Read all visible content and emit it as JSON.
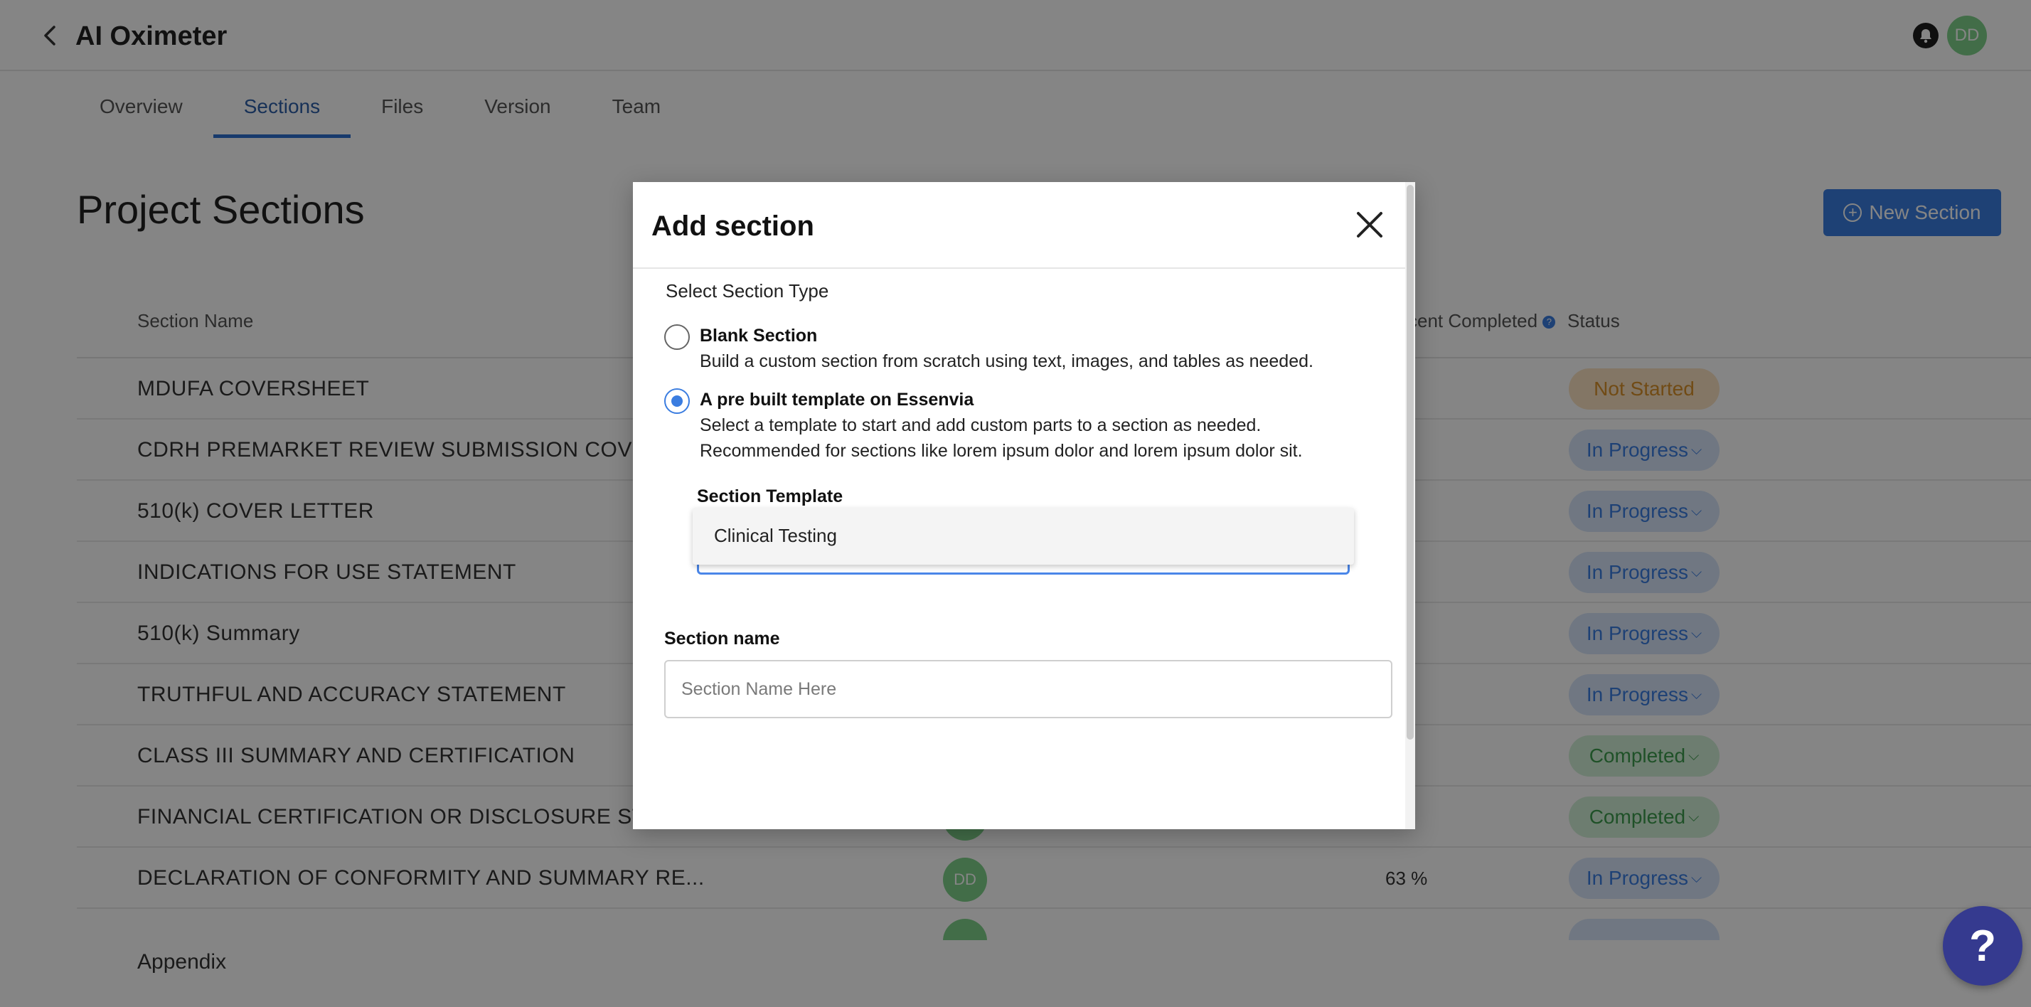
{
  "header": {
    "title": "AI Oximeter",
    "avatar_initials": "DD"
  },
  "tabs": [
    {
      "label": "Overview"
    },
    {
      "label": "Sections",
      "active": true
    },
    {
      "label": "Files"
    },
    {
      "label": "Version"
    },
    {
      "label": "Team"
    }
  ],
  "page": {
    "title": "Project Sections",
    "new_section_label": "New Section"
  },
  "table": {
    "col_name": "Section Name",
    "col_percent": "cent Completed",
    "col_status": "Status",
    "rows": [
      {
        "name": "MDUFA COVERSHEET",
        "owner": "",
        "percent": "",
        "status": "Not Started",
        "status_type": "notstarted"
      },
      {
        "name": "CDRH PREMARKET REVIEW SUBMISSION COVERS",
        "owner": "",
        "percent": "",
        "status": "In Progress",
        "status_type": "inprogress"
      },
      {
        "name": "510(k) COVER LETTER",
        "owner": "",
        "percent": "%",
        "status": "In Progress",
        "status_type": "inprogress"
      },
      {
        "name": "INDICATIONS FOR USE STATEMENT",
        "owner": "",
        "percent": "%",
        "status": "In Progress",
        "status_type": "inprogress"
      },
      {
        "name": "510(k) Summary",
        "owner": "",
        "percent": "%",
        "status": "In Progress",
        "status_type": "inprogress"
      },
      {
        "name": "TRUTHFUL AND ACCURACY STATEMENT",
        "owner": "",
        "percent": "%",
        "status": "In Progress",
        "status_type": "inprogress"
      },
      {
        "name": "CLASS III SUMMARY AND CERTIFICATION",
        "owner": "",
        "percent": "%",
        "status": "Completed",
        "status_type": "completed"
      },
      {
        "name": "FINANCIAL CERTIFICATION OR DISCLOSURE ST...",
        "owner": "",
        "percent": "%",
        "status": "Completed",
        "status_type": "completed"
      },
      {
        "name": "DECLARATION OF CONFORMITY AND SUMMARY RE...",
        "owner": "DD",
        "percent": "63 %",
        "status": "In Progress",
        "status_type": "inprogress"
      }
    ],
    "appendix_label": "Appendix"
  },
  "modal": {
    "title": "Add section",
    "type_label": "Select Section Type",
    "options": [
      {
        "title": "Blank Section",
        "desc1": "Build a custom section from scratch using text, images, and tables as needed.",
        "selected": false
      },
      {
        "title": "A pre built template on Essenvia",
        "desc1": "Select a template to start and add custom parts to a section as needed.",
        "desc2": "Recommended for sections like lorem ipsum dolor and lorem ipsum dolor sit.",
        "selected": true
      }
    ],
    "template_label": "Section Template",
    "template_options": [
      "Clinical Testing"
    ],
    "name_label": "Section name",
    "name_placeholder": "Section Name Here",
    "name_value": ""
  },
  "help_label": "?",
  "colors": {
    "accent": "#3b7de0",
    "help_button": "#353a8f",
    "avatar": "#7fd28a"
  }
}
